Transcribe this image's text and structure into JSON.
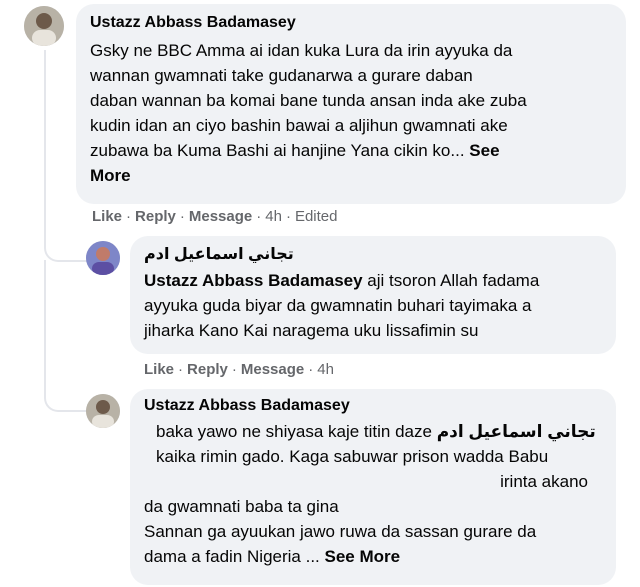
{
  "comments": [
    {
      "author": "Ustazz Abbass Badamasey",
      "lines": [
        "Gsky ne BBC Amma ai idan kuka Lura da irin ayyuka da",
        "wannan gwamnati take gudanarwa a gurare daban",
        "daban wannan ba komai bane tunda ansan inda ake zuba",
        "kudin idan an ciyo bashin bawai a aljihun gwamnati ake",
        "zubawa ba Kuma Bashi ai hanjine Yana cikin ko..."
      ],
      "see_more": "See",
      "see_more_2": "More",
      "actions": {
        "like": "Like",
        "reply": "Reply",
        "message": "Message",
        "time": "4h",
        "edited": "Edited"
      }
    },
    {
      "author": "تجاني اسماعيل ادم",
      "mention": "Ustazz Abbass Badamasey",
      "lines": [
        " aji tsoron Allah fadama",
        "ayyuka guda biyar da gwamnatin buhari tayimaka a",
        "jiharka Kano Kai naragema uku lissafimin su"
      ],
      "actions": {
        "like": "Like",
        "reply": "Reply",
        "message": "Message",
        "time": "4h"
      }
    },
    {
      "author": "Ustazz Abbass Badamasey",
      "rtl_name": "تجاني اسماعيل ادم",
      "line1": "baka yawo ne shiyasa kaje titin daze",
      "line2": "kaika rimin gado. Kaga sabuwar prison wadda Babu",
      "line3": "irinta akano",
      "line4": "da gwamnati baba ta gina",
      "line5": "Sannan ga ayuukan jawo ruwa da sassan gurare da",
      "line6": "dama a fadin Nigeria ...",
      "see_more": "See More"
    }
  ],
  "colors": {
    "bubble": "#f0f2f5",
    "meta": "#65676b",
    "text": "#050505"
  },
  "icons": [
    "avatar-photo"
  ]
}
